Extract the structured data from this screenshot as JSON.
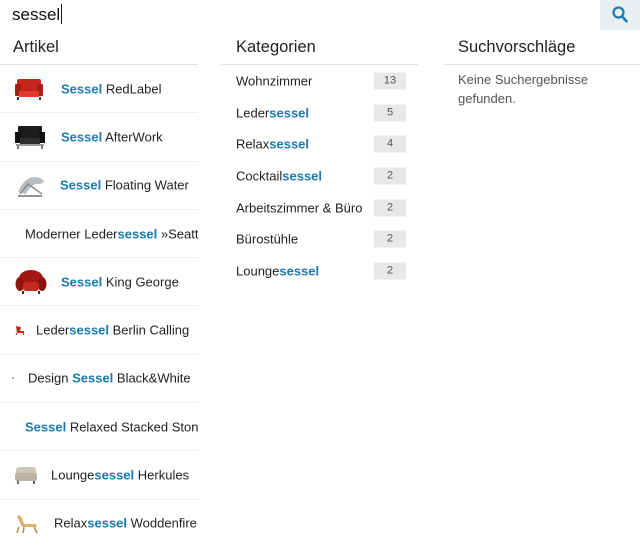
{
  "search": {
    "value": "sessel",
    "placeholder": "",
    "button_icon": "search-icon",
    "accent": "#1b7ab3"
  },
  "columns": {
    "articles_title": "Artikel",
    "categories_title": "Kategorien",
    "suggestions_title": "Suchvorschläge"
  },
  "articles": [
    {
      "pre": "",
      "hl": "Sessel",
      "post": " RedLabel",
      "thumb": "red-armchair-thumbnail"
    },
    {
      "pre": "",
      "hl": "Sessel",
      "post": " AfterWork",
      "thumb": "black-armchair-thumbnail"
    },
    {
      "pre": "",
      "hl": "Sessel",
      "post": " Floating Water",
      "thumb": "chrome-lounger-thumbnail"
    },
    {
      "pre": "Moderner Leder",
      "hl": "sessel",
      "post": " »Seattle",
      "thumb": ""
    },
    {
      "pre": "",
      "hl": "Sessel",
      "post": " King George",
      "thumb": "red-club-chair-thumbnail"
    },
    {
      "pre": "Leder",
      "hl": "sessel",
      "post": " Berlin Calling",
      "thumb": "small-red-chair-thumbnail"
    },
    {
      "pre": "Design ",
      "hl": "Sessel",
      "post": " Black&White",
      "thumb": ""
    },
    {
      "pre": "",
      "hl": "Sessel",
      "post": " Relaxed Stacked Stone",
      "thumb": ""
    },
    {
      "pre": "Lounge",
      "hl": "sessel",
      "post": " Herkules",
      "thumb": "beige-lounge-chair-thumbnail"
    },
    {
      "pre": "Relax",
      "hl": "sessel",
      "post": " Woddenfire",
      "thumb": "wooden-chair-thumbnail"
    }
  ],
  "categories": [
    {
      "pre": "Wohnzimmer",
      "hl": "",
      "post": "",
      "count": "13"
    },
    {
      "pre": "Leder",
      "hl": "sessel",
      "post": "",
      "count": "5"
    },
    {
      "pre": "Relax",
      "hl": "sessel",
      "post": "",
      "count": "4"
    },
    {
      "pre": "Cocktail",
      "hl": "sessel",
      "post": "",
      "count": "2"
    },
    {
      "pre": "Arbeitszimmer & Büro",
      "hl": "",
      "post": "",
      "count": "2"
    },
    {
      "pre": "Bürostühle",
      "hl": "",
      "post": "",
      "count": "2"
    },
    {
      "pre": "Lounge",
      "hl": "sessel",
      "post": "",
      "count": "2"
    }
  ],
  "suggestions": {
    "empty_text": "Keine Suchergebnisse gefunden."
  }
}
